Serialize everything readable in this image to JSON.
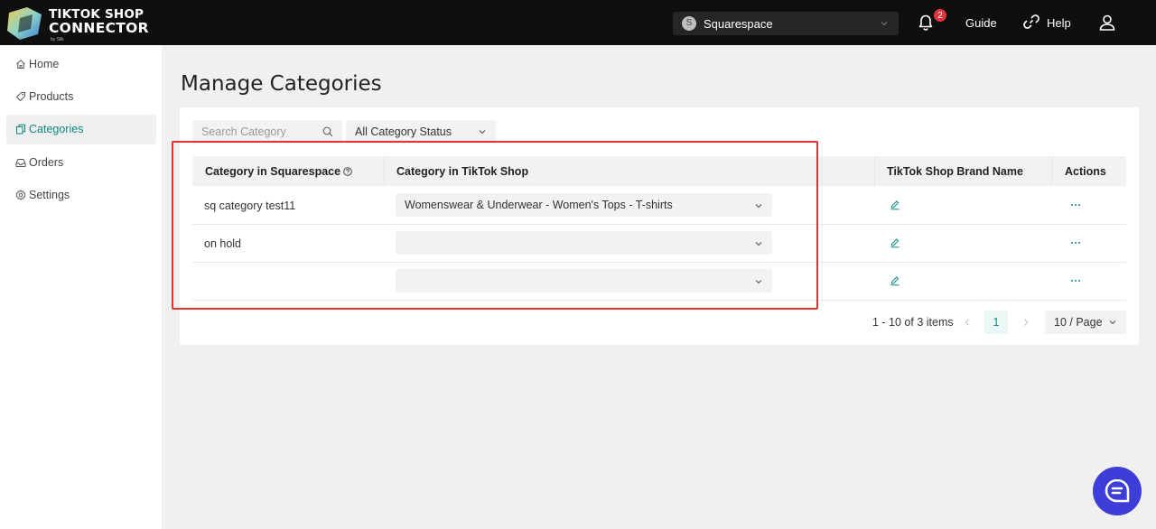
{
  "app": {
    "logo_line1": "TIKTOK SHOP",
    "logo_line2": "CONNECTOR",
    "logo_sub": "by Silk"
  },
  "header": {
    "shop_initial": "S",
    "shop_name": "Squarespace",
    "notification_count": "2",
    "guide_label": "Guide",
    "help_label": "Help"
  },
  "sidebar": {
    "items": [
      {
        "label": "Home",
        "icon": "home-icon"
      },
      {
        "label": "Products",
        "icon": "tag-icon"
      },
      {
        "label": "Categories",
        "icon": "copy-icon",
        "active": true
      },
      {
        "label": "Orders",
        "icon": "inbox-icon"
      },
      {
        "label": "Settings",
        "icon": "gear-icon"
      }
    ]
  },
  "main": {
    "title": "Manage Categories",
    "search_placeholder": "Search Category",
    "status_filter": "All Category Status",
    "columns": [
      "Category in Squarespace",
      "Category in TikTok Shop",
      "TikTok Shop Brand Name",
      "Actions"
    ],
    "rows": [
      {
        "squarespace_category": "sq category test11",
        "tiktok_category": "Womenswear & Underwear - Women's Tops - T-shirts"
      },
      {
        "squarespace_category": "on hold",
        "tiktok_category": ""
      },
      {
        "squarespace_category": "",
        "tiktok_category": ""
      }
    ],
    "pagination": {
      "info": "1 - 10 of 3 items",
      "current_page": "1",
      "page_size": "10  / Page"
    }
  },
  "colors": {
    "accent": "#0b8a7a",
    "highlight": "#e3322f",
    "badge": "#e0353f",
    "chat": "#3d3dd8"
  }
}
